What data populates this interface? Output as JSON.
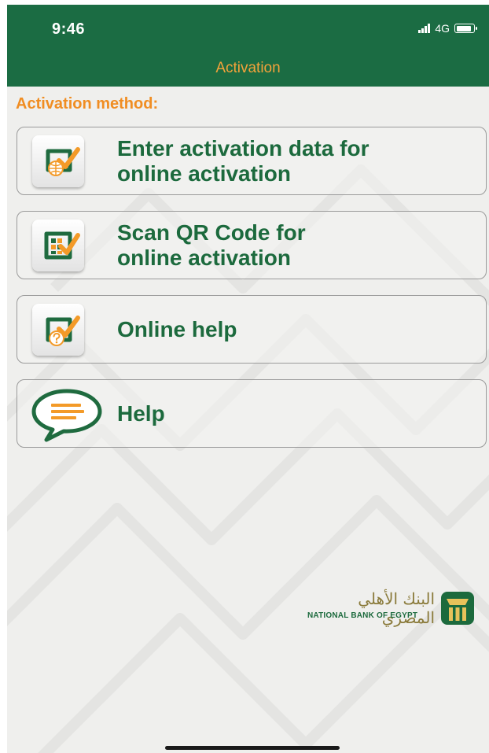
{
  "status_bar": {
    "time": "9:46",
    "network": "4G"
  },
  "header": {
    "title": "Activation"
  },
  "section_label": "Activation method:",
  "options": [
    {
      "line1": "Enter activation data for",
      "line2": "online activation",
      "icon": "globe-check-icon"
    },
    {
      "line1": "Scan QR Code for",
      "line2": "online activation",
      "icon": "qr-check-icon"
    },
    {
      "line1": "Online help",
      "line2": "",
      "icon": "question-check-icon"
    },
    {
      "line1": "Help",
      "line2": "",
      "icon": "speech-bubble-icon"
    }
  ],
  "logo": {
    "arabic": "البنك الأهلي المصري",
    "english": "NATIONAL BANK OF EGYPT"
  },
  "colors": {
    "header": "#1b6c43",
    "accent": "#f08d22",
    "label": "#1c6a3d"
  }
}
